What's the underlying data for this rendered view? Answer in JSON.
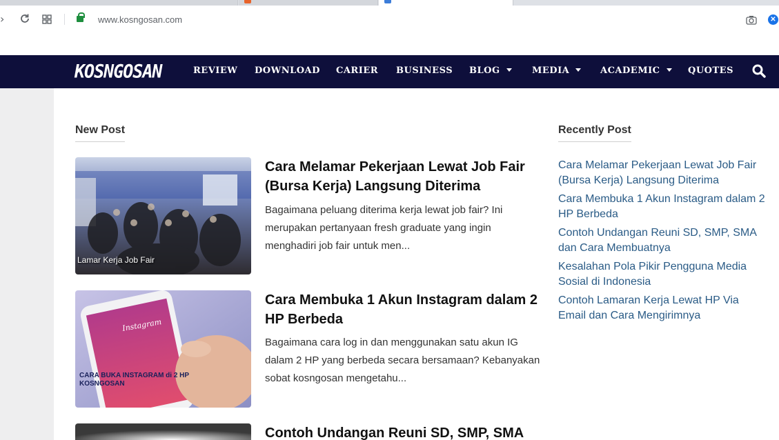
{
  "browser": {
    "url": "www.kosngosan.com"
  },
  "site": {
    "logo": "KOSNGOSAN"
  },
  "nav": {
    "items": [
      {
        "label": "REVIEW",
        "dropdown": false
      },
      {
        "label": "DOWNLOAD",
        "dropdown": false
      },
      {
        "label": "CARIER",
        "dropdown": false
      },
      {
        "label": "BUSINESS",
        "dropdown": false
      },
      {
        "label": "BLOG",
        "dropdown": true
      },
      {
        "label": "MEDIA",
        "dropdown": true
      },
      {
        "label": "ACADEMIC",
        "dropdown": true
      },
      {
        "label": "QUOTES",
        "dropdown": false
      }
    ],
    "search_icon": "search-icon"
  },
  "main": {
    "section_title": "New Post",
    "posts": [
      {
        "title": "Cara Melamar Pekerjaan Lewat Job Fair (Bursa Kerja) Langsung Diterima",
        "excerpt": "Bagaimana peluang diterima kerja lewat job fair? Ini merupakan pertanyaan fresh graduate yang ingin menghadiri job fair untuk men...",
        "thumb_caption": "Lamar Kerja Job Fair"
      },
      {
        "title": "Cara Membuka 1 Akun Instagram dalam 2 HP Berbeda",
        "excerpt": "Bagaimana cara log in dan menggunakan satu akun IG dalam 2 HP yang berbeda secara bersamaan? Kebanyakan sobat kosngosan mengetahu...",
        "thumb_caption": "CARA BUKA INSTAGRAM di 2 HP",
        "thumb_caption_sub": "KOSNGOSAN",
        "thumb_app_label": "Instagram"
      },
      {
        "title": "Contoh Undangan Reuni SD, SMP, SMA",
        "excerpt": ""
      }
    ]
  },
  "sidebar": {
    "title": "Recently Post",
    "items": [
      "Cara Melamar Pekerjaan Lewat Job Fair (Bursa Kerja) Langsung Diterima",
      "Cara Membuka 1 Akun Instagram dalam 2 HP Berbeda",
      "Contoh Undangan Reuni SD, SMP, SMA dan Cara Membuatnya",
      "Kesalahan Pola Pikir Pengguna Media Sosial di Indonesia",
      "Contoh Lamaran Kerja Lewat HP Via Email dan Cara Mengirimnya"
    ]
  },
  "colors": {
    "navbar_bg": "#0e0f3b",
    "link": "#2a5b86",
    "gutter": "#eeeeef"
  }
}
